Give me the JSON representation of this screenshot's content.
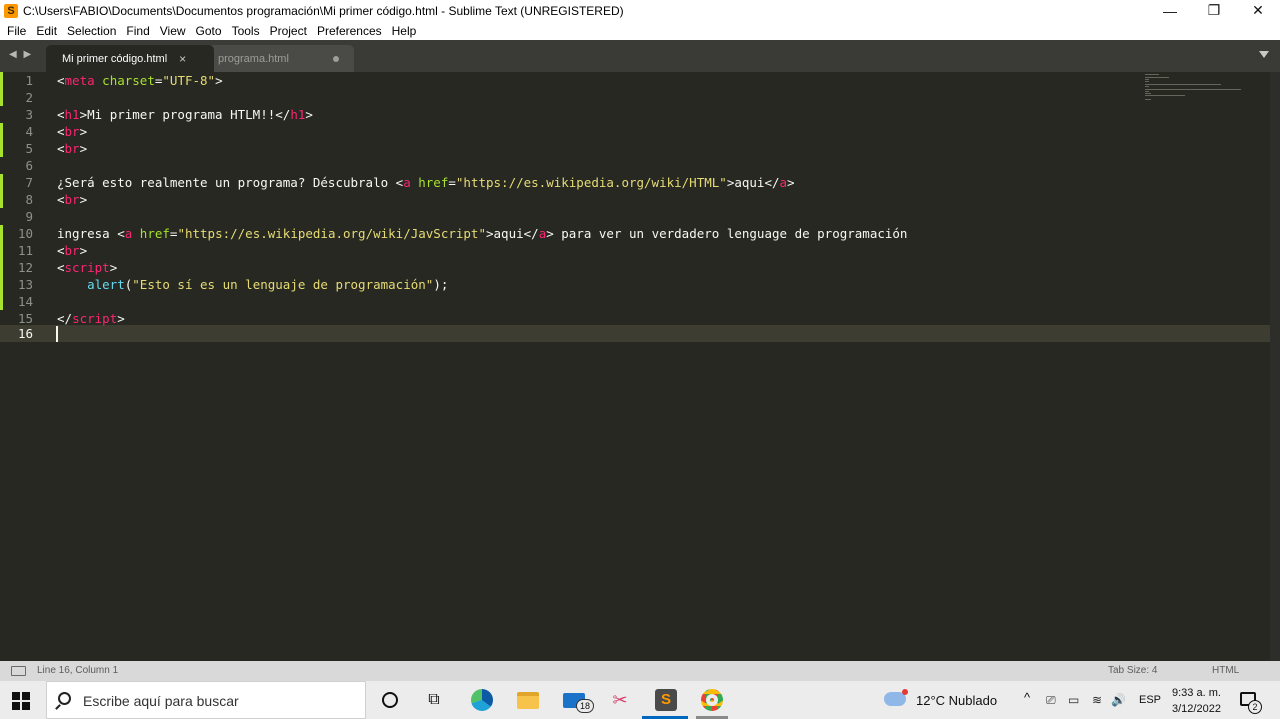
{
  "window": {
    "title": "C:\\Users\\FABIO\\Documents\\Documentos programación\\Mi primer código.html - Sublime Text (UNREGISTERED)",
    "app_icon_glyph": "S",
    "minimize_glyph": "—",
    "maximize_glyph": "❐",
    "close_glyph": "✕"
  },
  "menu": [
    "File",
    "Edit",
    "Selection",
    "Find",
    "View",
    "Goto",
    "Tools",
    "Project",
    "Preferences",
    "Help"
  ],
  "tabs": {
    "nav_glyph": "◀ ▶",
    "active": {
      "label": "Mi primer código.html",
      "close_glyph": "×"
    },
    "inactive": {
      "label": "programa.html"
    }
  },
  "editor": {
    "line_numbers": [
      "1",
      "2",
      "3",
      "4",
      "5",
      "6",
      "7",
      "8",
      "9",
      "10",
      "11",
      "12",
      "13",
      "14",
      "15",
      "16"
    ],
    "current_line": 16,
    "lines": {
      "l1": {
        "a": "<",
        "b": "meta",
        "c": " ",
        "d": "charset",
        "e": "=",
        "f": "\"UTF-8\"",
        "g": ">"
      },
      "l3": {
        "a": "<",
        "b": "h1",
        "c": ">Mi primer programa HTLM!!</",
        "d": "h1",
        "e": ">"
      },
      "l4": {
        "a": "<",
        "b": "br",
        "c": ">"
      },
      "l5": {
        "a": "<",
        "b": "br",
        "c": ">"
      },
      "l7": {
        "a": "¿Será esto realmente un programa? Déscubralo <",
        "b": "a",
        "c": " ",
        "d": "href",
        "e": "=",
        "f": "\"https://es.wikipedia.org/wiki/HTML\"",
        "g": ">aqui</",
        "h": "a",
        "i": ">"
      },
      "l8": {
        "a": "<",
        "b": "br",
        "c": ">"
      },
      "l10": {
        "a": "ingresa <",
        "b": "a",
        "c": " ",
        "d": "href",
        "e": "=",
        "f": "\"https://es.wikipedia.org/wiki/JavScript\"",
        "g": ">aqui</",
        "h": "a",
        "i": "> para ver un verdadero lenguage de programación"
      },
      "l11": {
        "a": "<",
        "b": "br",
        "c": ">"
      },
      "l12": {
        "a": "<",
        "b": "script",
        "c": ">"
      },
      "l13": {
        "a": "    ",
        "b": "alert",
        "c": "(",
        "d": "\"Esto sí es un lenguaje de programación\"",
        "e": ");"
      },
      "l15": {
        "a": "</",
        "b": "script",
        "c": ">"
      }
    }
  },
  "status": {
    "position": "Line 16, Column 1",
    "tab_size": "Tab Size: 4",
    "syntax": "HTML"
  },
  "taskbar": {
    "search_placeholder": "Escribe aquí para buscar",
    "mail_badge": "18",
    "sublime_glyph": "S",
    "taskview_glyph": "⧉",
    "snip_glyph": "✂",
    "weather": "12°C  Nublado",
    "tray_chevron": "^",
    "language": "ESP",
    "time": "9:33 a. m.",
    "date": "3/12/2022",
    "notification_count": "2",
    "tray_glyphs": {
      "meet": "⎚",
      "battery": "▭",
      "wifi": "≋",
      "volume": "🔊"
    }
  },
  "colors": {
    "editor_bg": "#272822",
    "keyword": "#f92672",
    "attribute": "#a6e22e",
    "string": "#e6db74",
    "function": "#66d9ef",
    "modified_marker": "#a6e22e"
  }
}
